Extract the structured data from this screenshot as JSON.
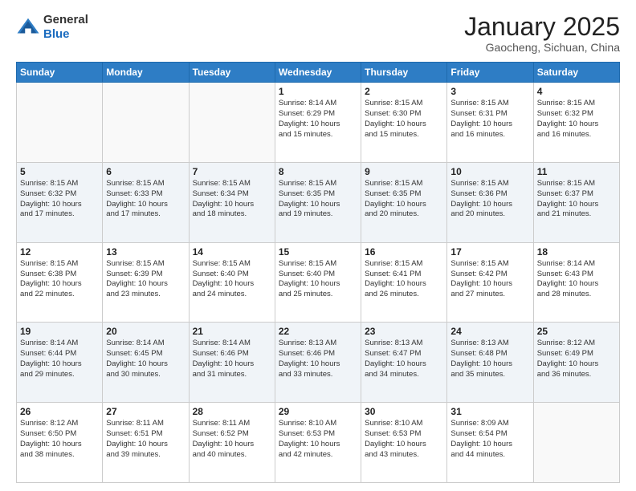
{
  "header": {
    "logo": {
      "general": "General",
      "blue": "Blue"
    },
    "title": "January 2025",
    "location": "Gaocheng, Sichuan, China"
  },
  "days_of_week": [
    "Sunday",
    "Monday",
    "Tuesday",
    "Wednesday",
    "Thursday",
    "Friday",
    "Saturday"
  ],
  "weeks": [
    {
      "alt": false,
      "days": [
        {
          "num": "",
          "info": ""
        },
        {
          "num": "",
          "info": ""
        },
        {
          "num": "",
          "info": ""
        },
        {
          "num": "1",
          "info": "Sunrise: 8:14 AM\nSunset: 6:29 PM\nDaylight: 10 hours\nand 15 minutes."
        },
        {
          "num": "2",
          "info": "Sunrise: 8:15 AM\nSunset: 6:30 PM\nDaylight: 10 hours\nand 15 minutes."
        },
        {
          "num": "3",
          "info": "Sunrise: 8:15 AM\nSunset: 6:31 PM\nDaylight: 10 hours\nand 16 minutes."
        },
        {
          "num": "4",
          "info": "Sunrise: 8:15 AM\nSunset: 6:32 PM\nDaylight: 10 hours\nand 16 minutes."
        }
      ]
    },
    {
      "alt": true,
      "days": [
        {
          "num": "5",
          "info": "Sunrise: 8:15 AM\nSunset: 6:32 PM\nDaylight: 10 hours\nand 17 minutes."
        },
        {
          "num": "6",
          "info": "Sunrise: 8:15 AM\nSunset: 6:33 PM\nDaylight: 10 hours\nand 17 minutes."
        },
        {
          "num": "7",
          "info": "Sunrise: 8:15 AM\nSunset: 6:34 PM\nDaylight: 10 hours\nand 18 minutes."
        },
        {
          "num": "8",
          "info": "Sunrise: 8:15 AM\nSunset: 6:35 PM\nDaylight: 10 hours\nand 19 minutes."
        },
        {
          "num": "9",
          "info": "Sunrise: 8:15 AM\nSunset: 6:35 PM\nDaylight: 10 hours\nand 20 minutes."
        },
        {
          "num": "10",
          "info": "Sunrise: 8:15 AM\nSunset: 6:36 PM\nDaylight: 10 hours\nand 20 minutes."
        },
        {
          "num": "11",
          "info": "Sunrise: 8:15 AM\nSunset: 6:37 PM\nDaylight: 10 hours\nand 21 minutes."
        }
      ]
    },
    {
      "alt": false,
      "days": [
        {
          "num": "12",
          "info": "Sunrise: 8:15 AM\nSunset: 6:38 PM\nDaylight: 10 hours\nand 22 minutes."
        },
        {
          "num": "13",
          "info": "Sunrise: 8:15 AM\nSunset: 6:39 PM\nDaylight: 10 hours\nand 23 minutes."
        },
        {
          "num": "14",
          "info": "Sunrise: 8:15 AM\nSunset: 6:40 PM\nDaylight: 10 hours\nand 24 minutes."
        },
        {
          "num": "15",
          "info": "Sunrise: 8:15 AM\nSunset: 6:40 PM\nDaylight: 10 hours\nand 25 minutes."
        },
        {
          "num": "16",
          "info": "Sunrise: 8:15 AM\nSunset: 6:41 PM\nDaylight: 10 hours\nand 26 minutes."
        },
        {
          "num": "17",
          "info": "Sunrise: 8:15 AM\nSunset: 6:42 PM\nDaylight: 10 hours\nand 27 minutes."
        },
        {
          "num": "18",
          "info": "Sunrise: 8:14 AM\nSunset: 6:43 PM\nDaylight: 10 hours\nand 28 minutes."
        }
      ]
    },
    {
      "alt": true,
      "days": [
        {
          "num": "19",
          "info": "Sunrise: 8:14 AM\nSunset: 6:44 PM\nDaylight: 10 hours\nand 29 minutes."
        },
        {
          "num": "20",
          "info": "Sunrise: 8:14 AM\nSunset: 6:45 PM\nDaylight: 10 hours\nand 30 minutes."
        },
        {
          "num": "21",
          "info": "Sunrise: 8:14 AM\nSunset: 6:46 PM\nDaylight: 10 hours\nand 31 minutes."
        },
        {
          "num": "22",
          "info": "Sunrise: 8:13 AM\nSunset: 6:46 PM\nDaylight: 10 hours\nand 33 minutes."
        },
        {
          "num": "23",
          "info": "Sunrise: 8:13 AM\nSunset: 6:47 PM\nDaylight: 10 hours\nand 34 minutes."
        },
        {
          "num": "24",
          "info": "Sunrise: 8:13 AM\nSunset: 6:48 PM\nDaylight: 10 hours\nand 35 minutes."
        },
        {
          "num": "25",
          "info": "Sunrise: 8:12 AM\nSunset: 6:49 PM\nDaylight: 10 hours\nand 36 minutes."
        }
      ]
    },
    {
      "alt": false,
      "days": [
        {
          "num": "26",
          "info": "Sunrise: 8:12 AM\nSunset: 6:50 PM\nDaylight: 10 hours\nand 38 minutes."
        },
        {
          "num": "27",
          "info": "Sunrise: 8:11 AM\nSunset: 6:51 PM\nDaylight: 10 hours\nand 39 minutes."
        },
        {
          "num": "28",
          "info": "Sunrise: 8:11 AM\nSunset: 6:52 PM\nDaylight: 10 hours\nand 40 minutes."
        },
        {
          "num": "29",
          "info": "Sunrise: 8:10 AM\nSunset: 6:53 PM\nDaylight: 10 hours\nand 42 minutes."
        },
        {
          "num": "30",
          "info": "Sunrise: 8:10 AM\nSunset: 6:53 PM\nDaylight: 10 hours\nand 43 minutes."
        },
        {
          "num": "31",
          "info": "Sunrise: 8:09 AM\nSunset: 6:54 PM\nDaylight: 10 hours\nand 44 minutes."
        },
        {
          "num": "",
          "info": ""
        }
      ]
    }
  ]
}
